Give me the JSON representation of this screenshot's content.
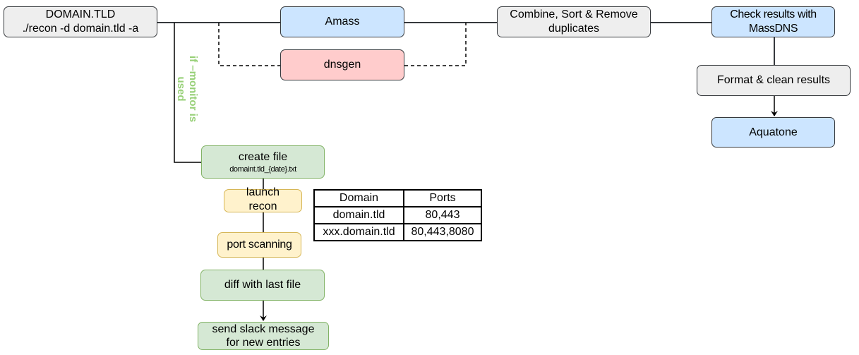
{
  "diagram": {
    "nodes": {
      "domain": {
        "line1": "DOMAIN.TLD",
        "line2": "./recon -d domain.tld -a"
      },
      "amass": {
        "label": "Amass"
      },
      "dnsgen": {
        "label": "dnsgen"
      },
      "combine": {
        "line1": "Combine, Sort & Remove",
        "line2": "duplicates"
      },
      "massdns": {
        "line1": "Check results with",
        "line2": "MassDNS"
      },
      "format": {
        "label": "Format & clean results"
      },
      "aquatone": {
        "label": "Aquatone"
      },
      "create_file": {
        "line1": "create file",
        "line2": "domaint.tld_{date}.txt"
      },
      "launch_recon": {
        "line1": "launch",
        "line2": "recon"
      },
      "port_scanning": {
        "label": "port scanning"
      },
      "diff": {
        "label": "diff with last file"
      },
      "slack": {
        "line1": "send slack message",
        "line2": "for new entries"
      }
    },
    "edge_labels": {
      "monitor_line1": "if –monitor is",
      "monitor_line2": "used"
    },
    "table": {
      "headers": [
        "Domain",
        "Ports"
      ],
      "rows": [
        [
          "domain.tld",
          "80,443"
        ],
        [
          "xxx.domain.tld",
          "80,443,8080"
        ]
      ]
    },
    "colors": {
      "gray_fill": "#eeeeee",
      "blue_fill": "#cce5ff",
      "red_fill": "#ffcccc",
      "green_fill": "#d5e8d4",
      "green_stroke": "#82b366",
      "yellow_fill": "#fff2cc",
      "yellow_stroke": "#d6b656",
      "label_green": "#97d077"
    }
  }
}
